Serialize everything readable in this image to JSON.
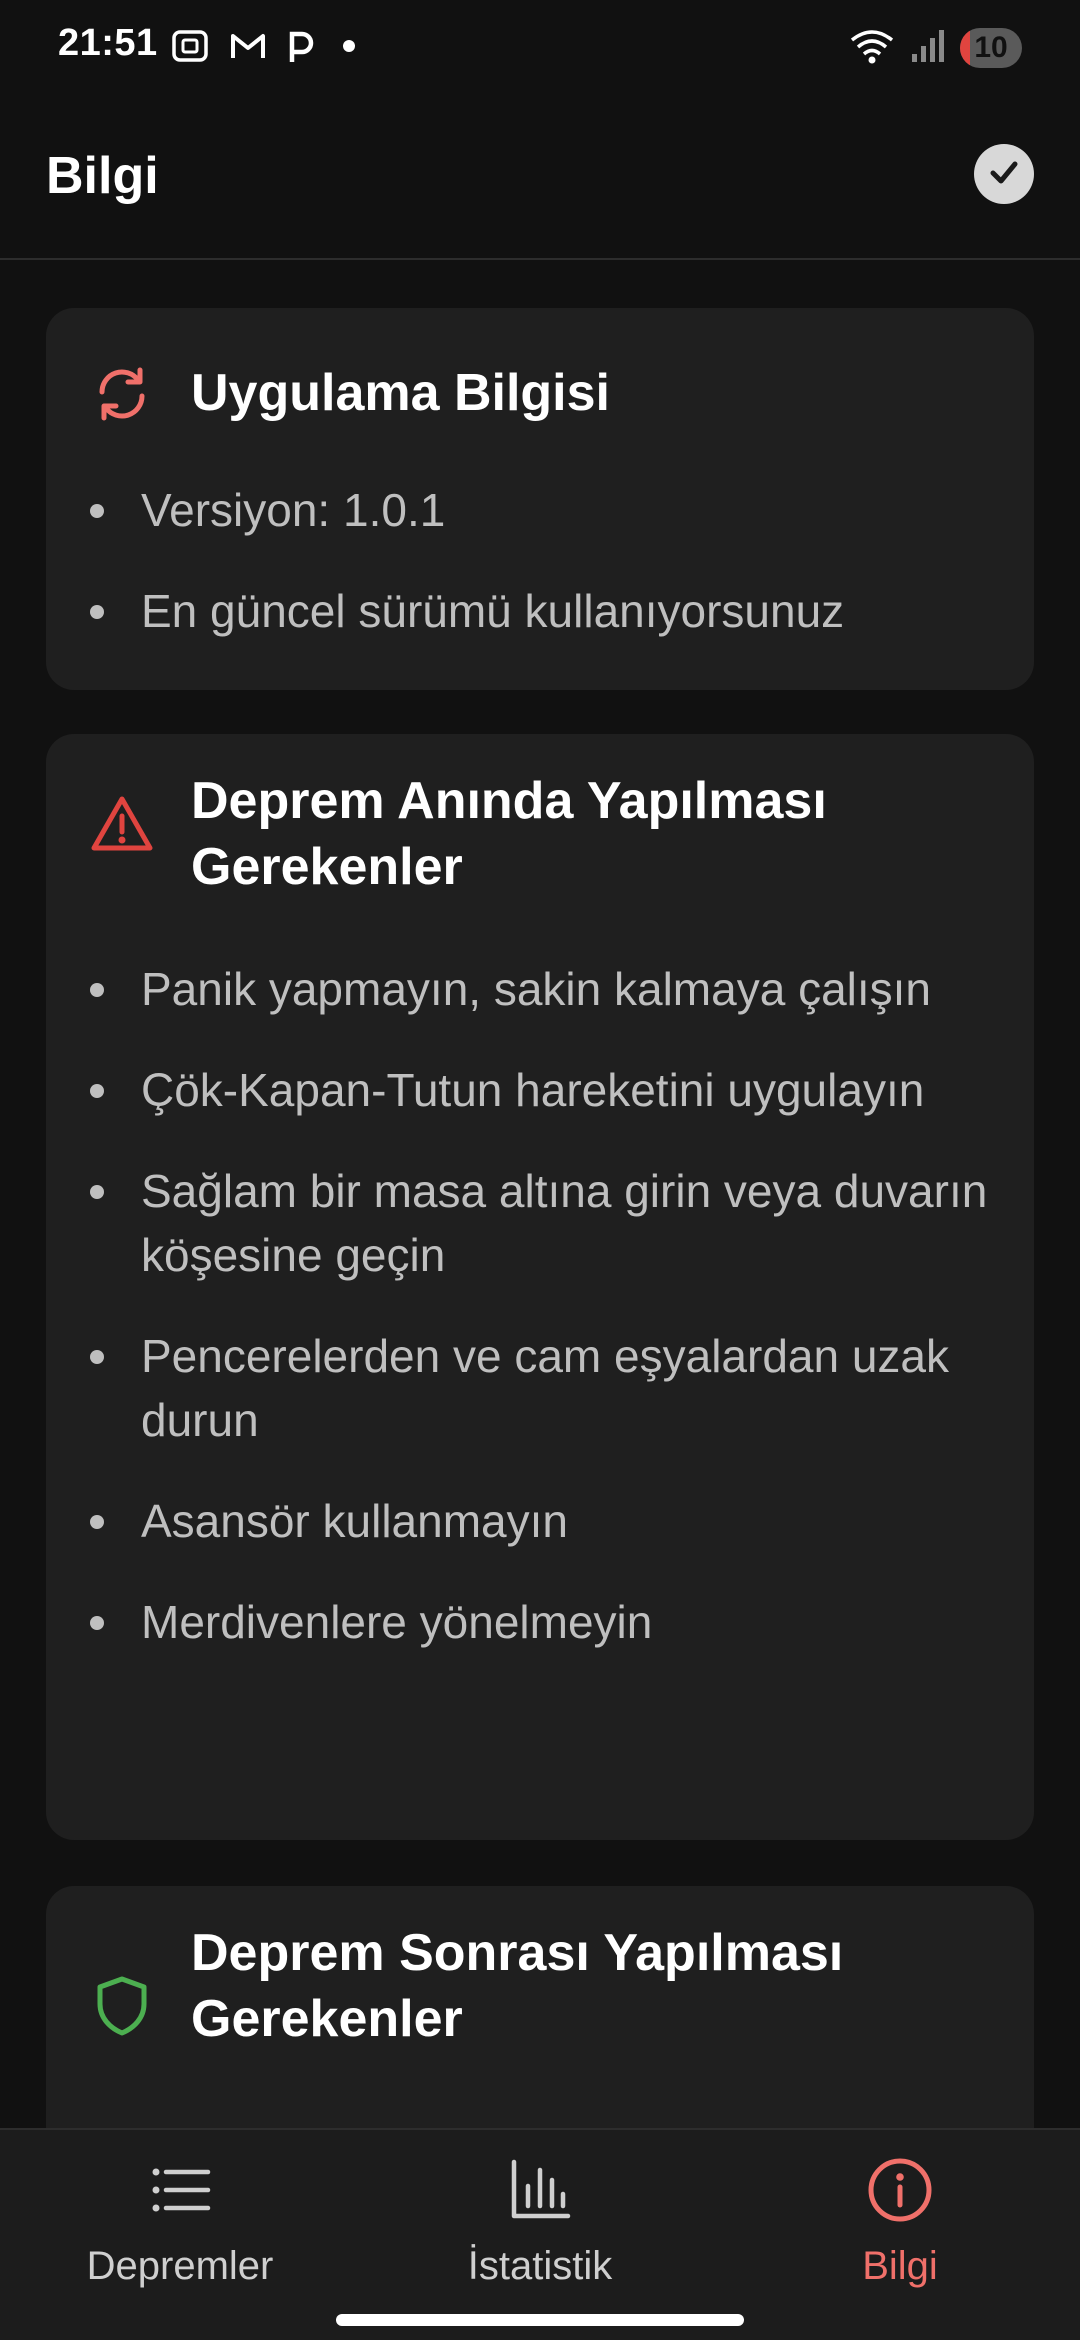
{
  "status_bar": {
    "time": "21:51",
    "battery": "10",
    "icons": [
      "screenshot-icon",
      "gmail-icon",
      "parking-app-icon",
      "notification-dot-icon",
      "wifi-icon",
      "signal-icon"
    ]
  },
  "app_bar": {
    "title": "Bilgi",
    "action_icon": "check-circle-icon"
  },
  "cards": {
    "app_info": {
      "icon": "refresh-icon",
      "icon_color": "#f0706a",
      "title": "Uygulama Bilgisi",
      "items": [
        "Versiyon: 1.0.1",
        "En güncel sürümü kullanıyorsunuz"
      ]
    },
    "during_quake": {
      "icon": "warning-triangle-icon",
      "icon_color": "#e0443f",
      "title": "Deprem Anında Yapılması Gerekenler",
      "items": [
        "Panik yapmayın, sakin kalmaya çalışın",
        "Çök-Kapan-Tutun hareketini uygulayın",
        "Sağlam bir masa altına girin veya duvarın köşesine geçin",
        "Pencerelerden ve cam eşyalardan uzak durun",
        "Asansör kullanmayın",
        "Merdivenlere yönelmeyin"
      ]
    },
    "after_quake": {
      "icon": "shield-icon",
      "icon_color": "#4caf50",
      "title": "Deprem Sonrası Yapılması Gerekenler"
    }
  },
  "bottom_nav": {
    "items": [
      {
        "label": "Depremler",
        "icon": "list-icon",
        "active": false
      },
      {
        "label": "İstatistik",
        "icon": "bar-chart-icon",
        "active": false
      },
      {
        "label": "Bilgi",
        "icon": "info-icon",
        "active": true
      }
    ],
    "active_color": "#f0706a"
  }
}
